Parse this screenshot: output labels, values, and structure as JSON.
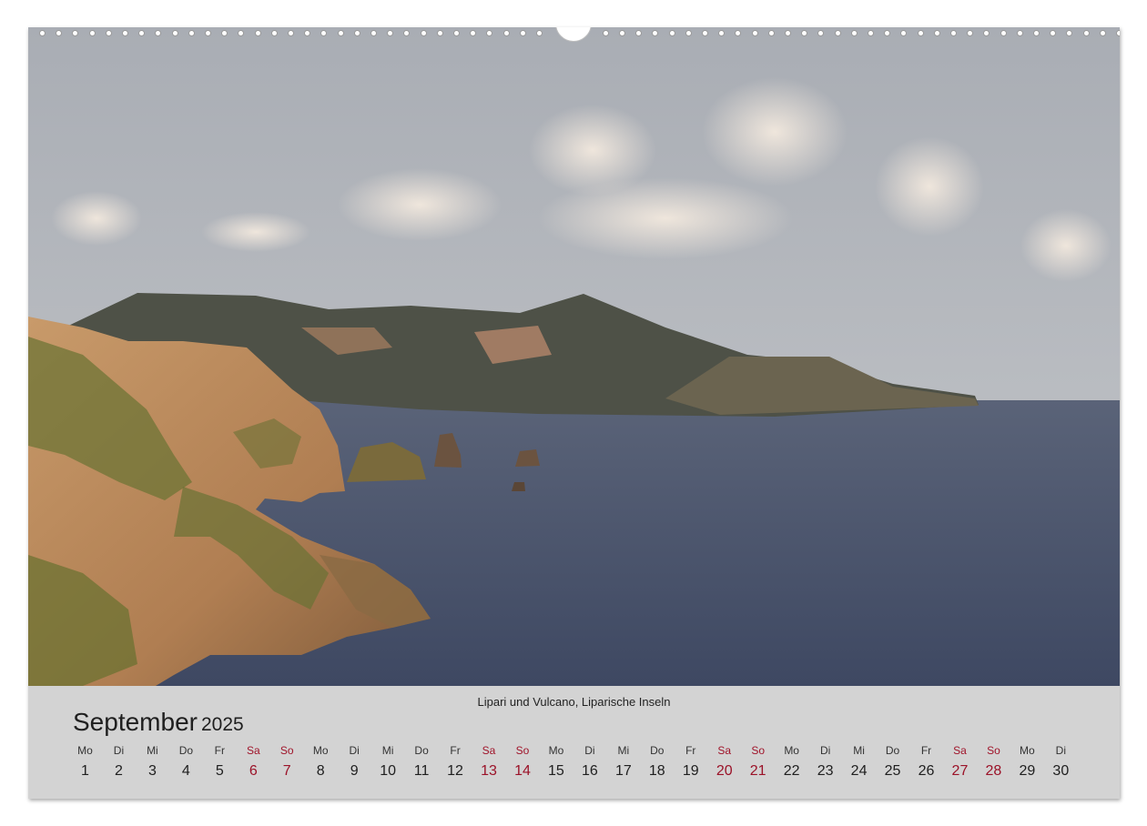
{
  "photo": {
    "caption": "Lipari und Vulcano, Liparische Inseln",
    "colors": {
      "sky": "#b3b7bd",
      "sea": "#46506a",
      "cliff": "#b98a5e",
      "vegetation": "#6a7235",
      "mountains": "#4c4f45"
    }
  },
  "calendar": {
    "month": "September",
    "year": "2025",
    "weekend_color": "#9b1228",
    "days": [
      {
        "name": "Mo",
        "num": "1"
      },
      {
        "name": "Di",
        "num": "2"
      },
      {
        "name": "Mi",
        "num": "3"
      },
      {
        "name": "Do",
        "num": "4"
      },
      {
        "name": "Fr",
        "num": "5"
      },
      {
        "name": "Sa",
        "num": "6"
      },
      {
        "name": "So",
        "num": "7"
      },
      {
        "name": "Mo",
        "num": "8"
      },
      {
        "name": "Di",
        "num": "9"
      },
      {
        "name": "Mi",
        "num": "10"
      },
      {
        "name": "Do",
        "num": "11"
      },
      {
        "name": "Fr",
        "num": "12"
      },
      {
        "name": "Sa",
        "num": "13"
      },
      {
        "name": "So",
        "num": "14"
      },
      {
        "name": "Mo",
        "num": "15"
      },
      {
        "name": "Di",
        "num": "16"
      },
      {
        "name": "Mi",
        "num": "17"
      },
      {
        "name": "Do",
        "num": "18"
      },
      {
        "name": "Fr",
        "num": "19"
      },
      {
        "name": "Sa",
        "num": "20"
      },
      {
        "name": "So",
        "num": "21"
      },
      {
        "name": "Mo",
        "num": "22"
      },
      {
        "name": "Di",
        "num": "23"
      },
      {
        "name": "Mi",
        "num": "24"
      },
      {
        "name": "Do",
        "num": "25"
      },
      {
        "name": "Fr",
        "num": "26"
      },
      {
        "name": "Sa",
        "num": "27"
      },
      {
        "name": "So",
        "num": "28"
      },
      {
        "name": "Mo",
        "num": "29"
      },
      {
        "name": "Di",
        "num": "30"
      }
    ]
  }
}
